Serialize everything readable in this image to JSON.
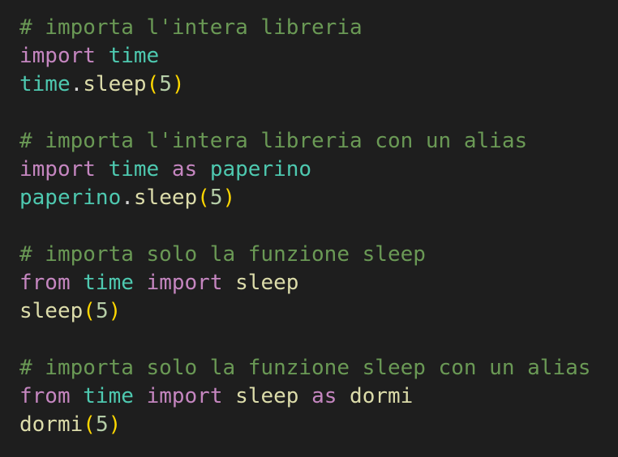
{
  "editor": {
    "background": "#1e1e1e",
    "colors": {
      "comment": "#6a9955",
      "keyword": "#c586c0",
      "module": "#4ec9b0",
      "function": "#dcdcaa",
      "number": "#b5cea8",
      "paren": "#ffd700",
      "punctuation": "#d4d4d4"
    },
    "lines": [
      [
        {
          "t": "comment",
          "v": "# importa l'intera libreria"
        }
      ],
      [
        {
          "t": "keyword",
          "v": "import"
        },
        {
          "t": "punct",
          "v": " "
        },
        {
          "t": "module",
          "v": "time"
        }
      ],
      [
        {
          "t": "module",
          "v": "time"
        },
        {
          "t": "punct",
          "v": "."
        },
        {
          "t": "func",
          "v": "sleep"
        },
        {
          "t": "paren",
          "v": "("
        },
        {
          "t": "number",
          "v": "5"
        },
        {
          "t": "paren",
          "v": ")"
        }
      ],
      [],
      [
        {
          "t": "comment",
          "v": "# importa l'intera libreria con un alias"
        }
      ],
      [
        {
          "t": "keyword",
          "v": "import"
        },
        {
          "t": "punct",
          "v": " "
        },
        {
          "t": "module",
          "v": "time"
        },
        {
          "t": "punct",
          "v": " "
        },
        {
          "t": "keyword",
          "v": "as"
        },
        {
          "t": "punct",
          "v": " "
        },
        {
          "t": "module",
          "v": "paperino"
        }
      ],
      [
        {
          "t": "module",
          "v": "paperino"
        },
        {
          "t": "punct",
          "v": "."
        },
        {
          "t": "func",
          "v": "sleep"
        },
        {
          "t": "paren",
          "v": "("
        },
        {
          "t": "number",
          "v": "5"
        },
        {
          "t": "paren",
          "v": ")"
        }
      ],
      [],
      [
        {
          "t": "comment",
          "v": "# importa solo la funzione sleep"
        }
      ],
      [
        {
          "t": "keyword",
          "v": "from"
        },
        {
          "t": "punct",
          "v": " "
        },
        {
          "t": "module",
          "v": "time"
        },
        {
          "t": "punct",
          "v": " "
        },
        {
          "t": "keyword",
          "v": "import"
        },
        {
          "t": "punct",
          "v": " "
        },
        {
          "t": "func",
          "v": "sleep"
        }
      ],
      [
        {
          "t": "func",
          "v": "sleep"
        },
        {
          "t": "paren",
          "v": "("
        },
        {
          "t": "number",
          "v": "5"
        },
        {
          "t": "paren",
          "v": ")"
        }
      ],
      [],
      [
        {
          "t": "comment",
          "v": "# importa solo la funzione sleep con un alias"
        }
      ],
      [
        {
          "t": "keyword",
          "v": "from"
        },
        {
          "t": "punct",
          "v": " "
        },
        {
          "t": "module",
          "v": "time"
        },
        {
          "t": "punct",
          "v": " "
        },
        {
          "t": "keyword",
          "v": "import"
        },
        {
          "t": "punct",
          "v": " "
        },
        {
          "t": "func",
          "v": "sleep"
        },
        {
          "t": "punct",
          "v": " "
        },
        {
          "t": "keyword",
          "v": "as"
        },
        {
          "t": "punct",
          "v": " "
        },
        {
          "t": "func",
          "v": "dormi"
        }
      ],
      [
        {
          "t": "func",
          "v": "dormi"
        },
        {
          "t": "paren",
          "v": "("
        },
        {
          "t": "number",
          "v": "5"
        },
        {
          "t": "paren",
          "v": ")"
        }
      ]
    ]
  }
}
